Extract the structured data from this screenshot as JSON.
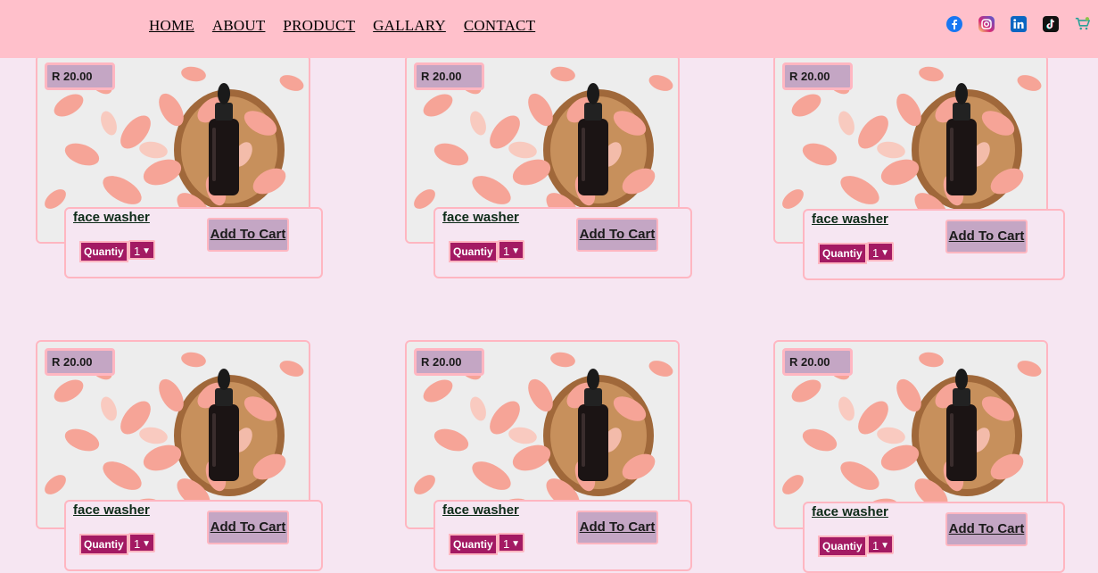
{
  "nav": {
    "links": [
      "HOME",
      "ABOUT",
      "PRODUCT",
      "GALLARY",
      "CONTACT"
    ],
    "socials": [
      "facebook-icon",
      "instagram-icon",
      "linkedin-icon",
      "tiktok-icon",
      "cart-icon"
    ]
  },
  "colors": {
    "header": "#ffc0cb",
    "background": "#f6e6f2",
    "accent": "#a31a63",
    "button": "#c4a6c4",
    "border": "#ffb6c1"
  },
  "products": [
    {
      "price": "R 20.00",
      "name": "face washer",
      "qty_label": "Quantiy",
      "qty_value": "1",
      "button": "Add To Cart"
    },
    {
      "price": "R 20.00",
      "name": "face washer",
      "qty_label": "Quantiy",
      "qty_value": "1",
      "button": "Add To Cart"
    },
    {
      "price": "R 20.00",
      "name": "face washer",
      "qty_label": "Quantiy",
      "qty_value": "1",
      "button": "Add To Cart"
    },
    {
      "price": "R 20.00",
      "name": "face washer",
      "qty_label": "Quantiy",
      "qty_value": "1",
      "button": "Add To Cart"
    },
    {
      "price": "R 20.00",
      "name": "face washer",
      "qty_label": "Quantiy",
      "qty_value": "1",
      "button": "Add To Cart"
    },
    {
      "price": "R 20.00",
      "name": "face washer",
      "qty_label": "Quantiy",
      "qty_value": "1",
      "button": "Add To Cart"
    }
  ]
}
